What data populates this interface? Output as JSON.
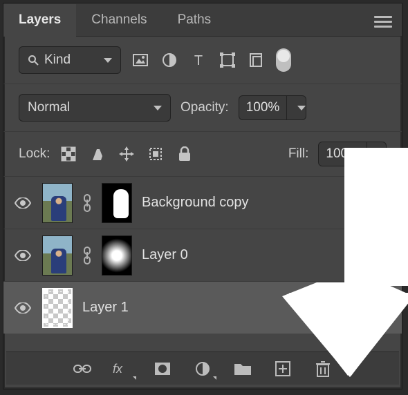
{
  "tabs": {
    "layers": "Layers",
    "channels": "Channels",
    "paths": "Paths"
  },
  "filter": {
    "kind": "Kind"
  },
  "blend": {
    "mode": "Normal",
    "opacity_label": "Opacity:",
    "opacity_value": "100%"
  },
  "lock": {
    "label": "Lock:",
    "fill_label": "Fill:",
    "fill_value": "100%"
  },
  "layers_list": [
    {
      "name": "Background copy"
    },
    {
      "name": "Layer 0"
    },
    {
      "name": "Layer 1"
    }
  ]
}
